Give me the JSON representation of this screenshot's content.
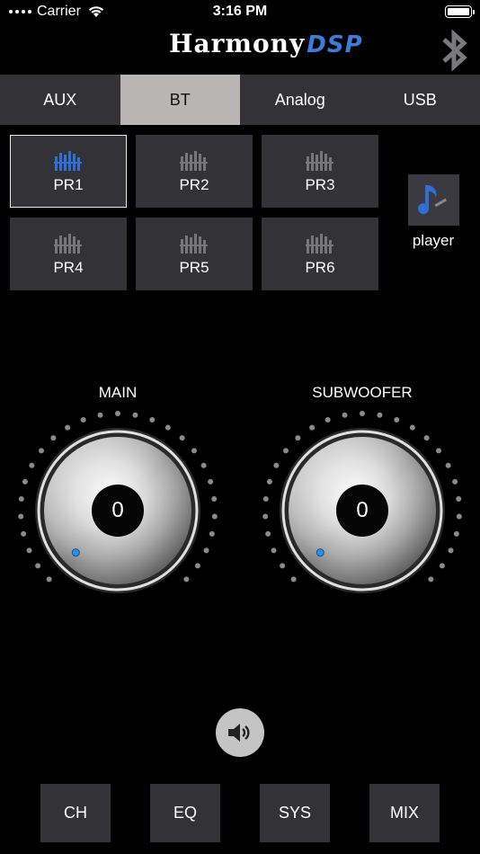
{
  "status_bar": {
    "carrier": "Carrier",
    "time": "3:16 PM"
  },
  "header": {
    "logo_main": "Harmony",
    "logo_accent": "DSP",
    "bluetooth_icon": "bluetooth-icon"
  },
  "source_tabs": [
    {
      "label": "AUX",
      "active": false
    },
    {
      "label": "BT",
      "active": true
    },
    {
      "label": "Analog",
      "active": false
    },
    {
      "label": "USB",
      "active": false
    }
  ],
  "presets": [
    {
      "label": "PR1",
      "active": true
    },
    {
      "label": "PR2",
      "active": false
    },
    {
      "label": "PR3",
      "active": false
    },
    {
      "label": "PR4",
      "active": false
    },
    {
      "label": "PR5",
      "active": false
    },
    {
      "label": "PR6",
      "active": false
    }
  ],
  "player": {
    "label": "player",
    "icon": "music-note-icon"
  },
  "knobs": {
    "main": {
      "title": "MAIN",
      "value": "0"
    },
    "subwoofer": {
      "title": "SUBWOOFER",
      "value": "0"
    }
  },
  "mute": {
    "icon": "speaker-icon"
  },
  "bottom_nav": [
    {
      "label": "CH"
    },
    {
      "label": "EQ"
    },
    {
      "label": "SYS"
    },
    {
      "label": "MIX"
    }
  ],
  "colors": {
    "accent_blue": "#2f6fd6",
    "inactive_icon": "#77777b",
    "panel": "#333337",
    "active_tab": "#b7b6b3"
  }
}
